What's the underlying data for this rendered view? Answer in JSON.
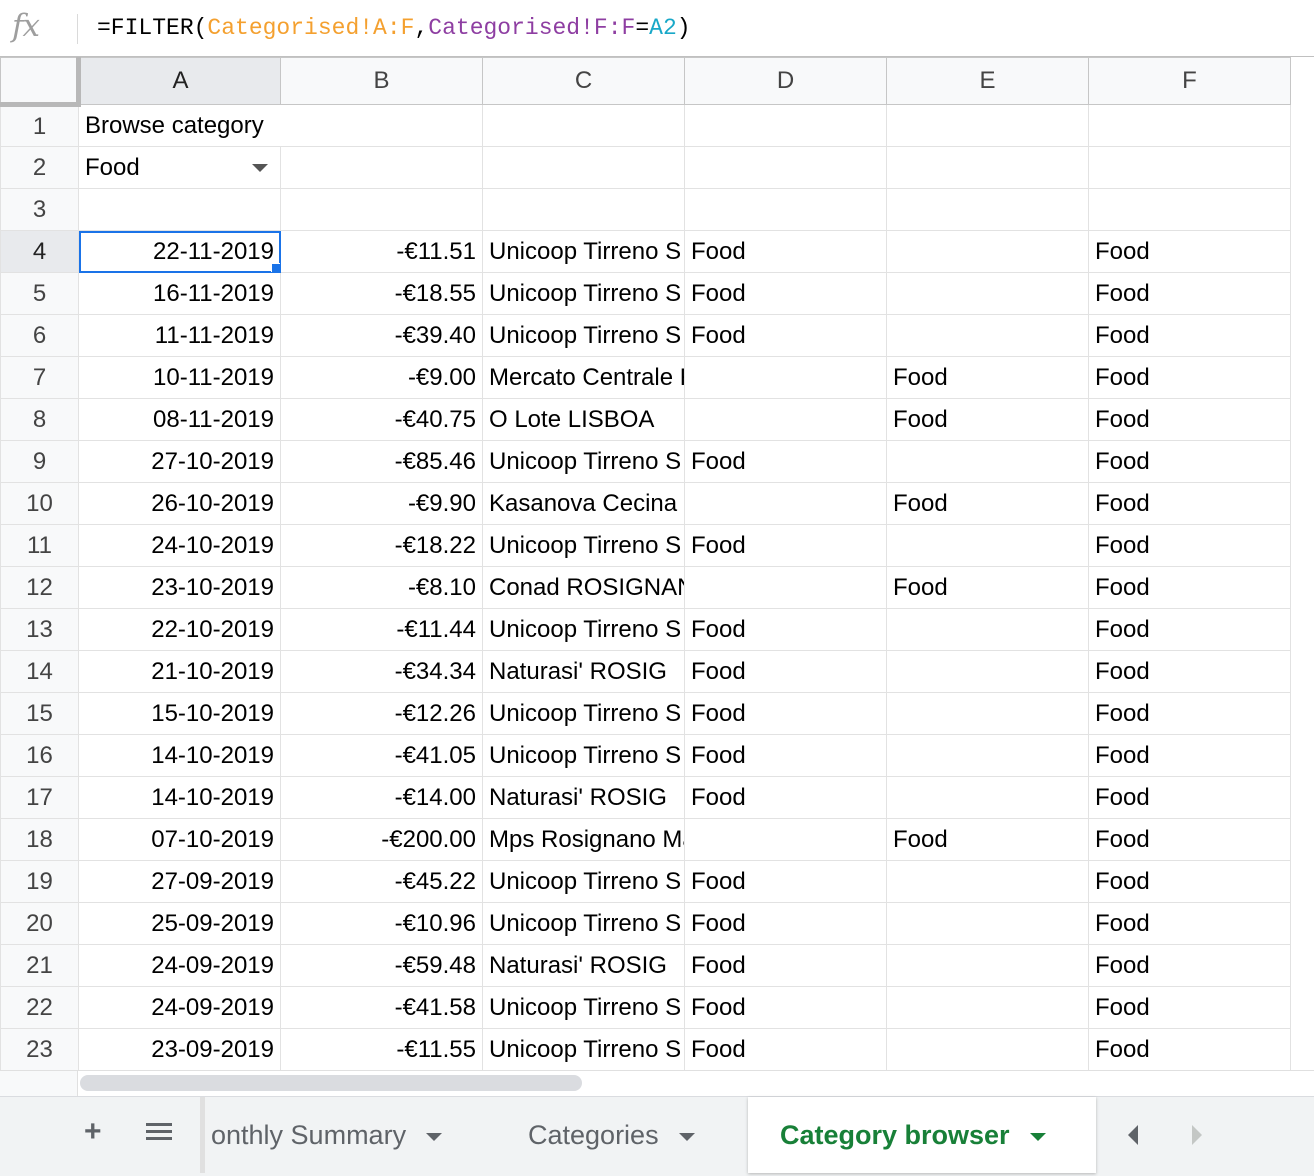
{
  "formula": {
    "prefix": "=FILTER(",
    "range1": "Categorised!A:F",
    "comma": ",",
    "range2": "Categorised!F:F",
    "eq": "=",
    "ref": "A2",
    "suffix": ")"
  },
  "columns": [
    "A",
    "B",
    "C",
    "D",
    "E",
    "F"
  ],
  "header_rows": {
    "r1": {
      "num": "1",
      "a": "Browse category"
    },
    "r2": {
      "num": "2",
      "a": "Food"
    },
    "r3": {
      "num": "3"
    }
  },
  "rows": [
    {
      "num": "4",
      "date": "22-11-2019",
      "amount": "-€11.51",
      "desc": "Unicoop Tirreno S",
      "d": "Food",
      "e": "",
      "f": "Food"
    },
    {
      "num": "5",
      "date": "16-11-2019",
      "amount": "-€18.55",
      "desc": "Unicoop Tirreno S",
      "d": "Food",
      "e": "",
      "f": "Food"
    },
    {
      "num": "6",
      "date": "11-11-2019",
      "amount": "-€39.40",
      "desc": "Unicoop Tirreno S",
      "d": "Food",
      "e": "",
      "f": "Food"
    },
    {
      "num": "7",
      "date": "10-11-2019",
      "amount": "-€9.00",
      "desc": "Mercato Centrale Roma ROMA",
      "d": "",
      "e": "Food",
      "f": "Food"
    },
    {
      "num": "8",
      "date": "08-11-2019",
      "amount": "-€40.75",
      "desc": "O Lote LISBOA",
      "d": "",
      "e": "Food",
      "f": "Food"
    },
    {
      "num": "9",
      "date": "27-10-2019",
      "amount": "-€85.46",
      "desc": "Unicoop Tirreno S",
      "d": "Food",
      "e": "",
      "f": "Food"
    },
    {
      "num": "10",
      "date": "26-10-2019",
      "amount": "-€9.90",
      "desc": "Kasanova Cecina CECINA",
      "d": "",
      "e": "Food",
      "f": "Food"
    },
    {
      "num": "11",
      "date": "24-10-2019",
      "amount": "-€18.22",
      "desc": "Unicoop Tirreno S",
      "d": "Food",
      "e": "",
      "f": "Food"
    },
    {
      "num": "12",
      "date": "23-10-2019",
      "amount": "-€8.10",
      "desc": "Conad ROSIGNANO MAR",
      "d": "",
      "e": "Food",
      "f": "Food"
    },
    {
      "num": "13",
      "date": "22-10-2019",
      "amount": "-€11.44",
      "desc": "Unicoop Tirreno S",
      "d": "Food",
      "e": "",
      "f": "Food"
    },
    {
      "num": "14",
      "date": "21-10-2019",
      "amount": "-€34.34",
      "desc": "Naturasi' ROSIG",
      "d": "Food",
      "e": "",
      "f": "Food"
    },
    {
      "num": "15",
      "date": "15-10-2019",
      "amount": "-€12.26",
      "desc": "Unicoop Tirreno S",
      "d": "Food",
      "e": "",
      "f": "Food"
    },
    {
      "num": "16",
      "date": "14-10-2019",
      "amount": "-€41.05",
      "desc": "Unicoop Tirreno S",
      "d": "Food",
      "e": "",
      "f": "Food"
    },
    {
      "num": "17",
      "date": "14-10-2019",
      "amount": "-€14.00",
      "desc": "Naturasi' ROSIG",
      "d": "Food",
      "e": "",
      "f": "Food"
    },
    {
      "num": "18",
      "date": "07-10-2019",
      "amount": "-€200.00",
      "desc": "Mps Rosignano Marittim ROSIGNA",
      "d": "",
      "e": "Food",
      "f": "Food"
    },
    {
      "num": "19",
      "date": "27-09-2019",
      "amount": "-€45.22",
      "desc": "Unicoop Tirreno S",
      "d": "Food",
      "e": "",
      "f": "Food"
    },
    {
      "num": "20",
      "date": "25-09-2019",
      "amount": "-€10.96",
      "desc": "Unicoop Tirreno S",
      "d": "Food",
      "e": "",
      "f": "Food"
    },
    {
      "num": "21",
      "date": "24-09-2019",
      "amount": "-€59.48",
      "desc": "Naturasi' ROSIG",
      "d": "Food",
      "e": "",
      "f": "Food"
    },
    {
      "num": "22",
      "date": "24-09-2019",
      "amount": "-€41.58",
      "desc": "Unicoop Tirreno S",
      "d": "Food",
      "e": "",
      "f": "Food"
    },
    {
      "num": "23",
      "date": "23-09-2019",
      "amount": "-€11.55",
      "desc": "Unicoop Tirreno S",
      "d": "Food",
      "e": "",
      "f": "Food"
    }
  ],
  "tabs": {
    "add": "+",
    "monthly": "onthly Summary",
    "categories": "Categories",
    "browser": "Category browser"
  },
  "colors": {
    "selection": "#1a73e8",
    "active_tab_text": "#188038",
    "formula_range1": "#f4a02f",
    "formula_range2": "#8e3ea2",
    "formula_ref": "#18a8c8"
  },
  "icons": {
    "formula": "fx-icon",
    "add_sheet": "plus-icon",
    "all_sheets": "menu-icon",
    "dropdown": "caret-down-icon",
    "nav_left": "caret-left-icon",
    "nav_right": "caret-right-icon"
  }
}
